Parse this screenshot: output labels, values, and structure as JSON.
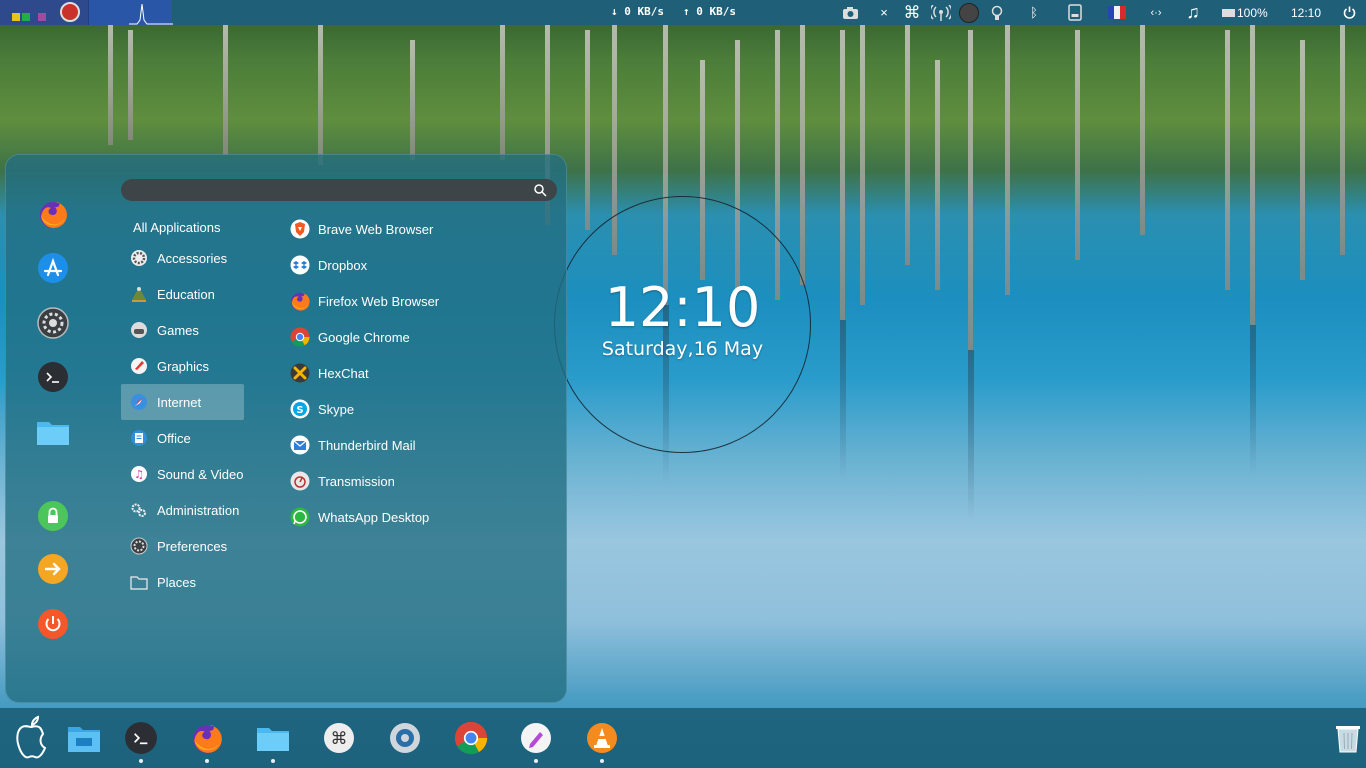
{
  "top_panel": {
    "download_speed": "↓ 0 KB/s",
    "upload_speed": "↑ 0 KB/s",
    "battery": "100%",
    "time": "12:10",
    "close_glyph": "×",
    "network_glyph": "‹·›",
    "workspace_colors": [
      "#e8c51a",
      "#2aa84a",
      "#a04aa0"
    ]
  },
  "menu": {
    "search": {
      "placeholder": "",
      "value": ""
    },
    "favorites": [
      {
        "icon": "firefox-icon"
      },
      {
        "icon": "app-store-icon"
      },
      {
        "icon": "settings-icon"
      },
      {
        "icon": "terminal-icon"
      },
      {
        "icon": "folder-icon"
      },
      {
        "icon": "lock-icon"
      },
      {
        "icon": "logout-icon"
      },
      {
        "icon": "power-icon"
      }
    ],
    "categories": [
      {
        "label": "All Applications",
        "icon": ""
      },
      {
        "label": "Accessories",
        "icon": "accessories-icon"
      },
      {
        "label": "Education",
        "icon": "education-icon"
      },
      {
        "label": "Games",
        "icon": "games-icon"
      },
      {
        "label": "Graphics",
        "icon": "graphics-icon"
      },
      {
        "label": "Internet",
        "icon": "internet-icon",
        "selected": true
      },
      {
        "label": "Office",
        "icon": "office-icon"
      },
      {
        "label": "Sound & Video",
        "icon": "sound-video-icon"
      },
      {
        "label": "Administration",
        "icon": "administration-icon"
      },
      {
        "label": "Preferences",
        "icon": "preferences-icon"
      },
      {
        "label": "Places",
        "icon": "places-icon"
      }
    ],
    "apps": [
      {
        "label": "Brave Web Browser",
        "icon": "brave-icon"
      },
      {
        "label": "Dropbox",
        "icon": "dropbox-icon"
      },
      {
        "label": "Firefox Web Browser",
        "icon": "firefox-icon"
      },
      {
        "label": "Google Chrome",
        "icon": "chrome-icon"
      },
      {
        "label": "HexChat",
        "icon": "hexchat-icon"
      },
      {
        "label": "Skype",
        "icon": "skype-icon"
      },
      {
        "label": "Thunderbird Mail",
        "icon": "thunderbird-icon"
      },
      {
        "label": "Transmission",
        "icon": "transmission-icon"
      },
      {
        "label": "WhatsApp Desktop",
        "icon": "whatsapp-icon"
      }
    ]
  },
  "desktop_clock": {
    "time": "12:10",
    "date": "Saturday,16 May"
  },
  "dock": {
    "items": [
      {
        "icon": "apple-logo-icon"
      },
      {
        "icon": "file-manager-icon"
      },
      {
        "icon": "terminal-icon",
        "running": true
      },
      {
        "icon": "firefox-icon",
        "running": true
      },
      {
        "icon": "folder-icon",
        "running": true
      },
      {
        "icon": "command-icon"
      },
      {
        "icon": "disk-icon"
      },
      {
        "icon": "chrome-icon"
      },
      {
        "icon": "text-editor-icon",
        "running": true
      },
      {
        "icon": "vlc-icon",
        "running": true
      },
      {
        "icon": "trash-icon"
      }
    ]
  }
}
